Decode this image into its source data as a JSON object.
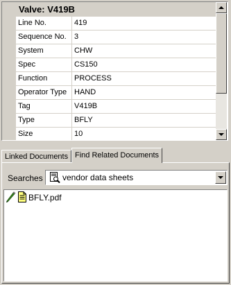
{
  "property_grid": {
    "category_title": "Valve: V419B",
    "properties": [
      {
        "name": "Line No.",
        "value": "419"
      },
      {
        "name": "Sequence No.",
        "value": "3"
      },
      {
        "name": "System",
        "value": "CHW"
      },
      {
        "name": "Spec",
        "value": "CS150"
      },
      {
        "name": "Function",
        "value": "PROCESS"
      },
      {
        "name": "Operator Type",
        "value": "HAND"
      },
      {
        "name": "Tag",
        "value": "V419B"
      },
      {
        "name": "Type",
        "value": "BFLY"
      },
      {
        "name": "Size",
        "value": "10"
      }
    ]
  },
  "tabs": [
    {
      "label": "Linked Documents"
    },
    {
      "label": "Find Related Documents"
    }
  ],
  "search": {
    "label": "Searches",
    "selected": "vendor data sheets"
  },
  "results": [
    {
      "label": "BFLY.pdf",
      "icon": "pdf-document-icon"
    }
  ],
  "colors": {
    "window_face": "#d4d0c8",
    "grid_line": "#d4d0c8",
    "pencil_green": "#3a8a22",
    "document_yellow": "#ffff80"
  }
}
